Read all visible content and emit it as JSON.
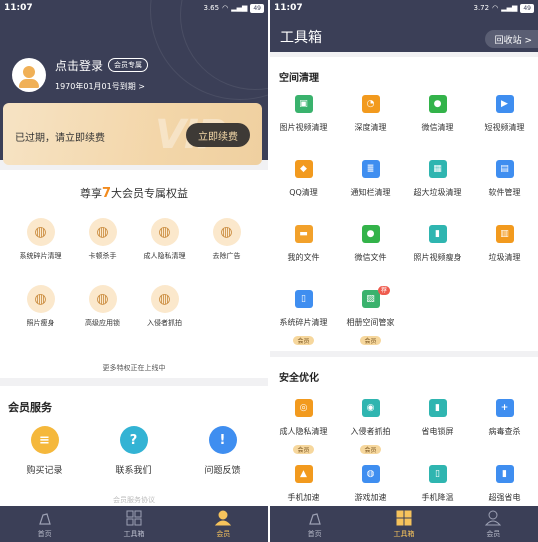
{
  "status_left": {
    "time": "11:07",
    "speed": "3.65\nKB/s"
  },
  "status_right": {
    "time": "11:07",
    "speed": "3.72\nKB/s"
  },
  "battery": "49",
  "account": {
    "login_text": "点击登录",
    "vip_chip": "会员专属",
    "expire_text": "1970年01月01号到期 >",
    "expired_msg": "已过期，请立即续费",
    "renew_button": "立即续费",
    "watermark": "VIP"
  },
  "benefits": {
    "title_pre": "尊享",
    "title_num": "7",
    "title_post": "大会员专属权益",
    "items": [
      {
        "label": "系统碎片清理",
        "icon": "phone-broom-icon"
      },
      {
        "label": "卡顿杀手",
        "icon": "rocket-icon"
      },
      {
        "label": "成人隐私清理",
        "icon": "privacy-icon"
      },
      {
        "label": "去除广告",
        "icon": "no-ad-icon"
      },
      {
        "label": "照片瘦身",
        "icon": "photo-compress-icon"
      },
      {
        "label": "高级应用锁",
        "icon": "lock-icon"
      },
      {
        "label": "入侵者抓拍",
        "icon": "camera-face-icon"
      }
    ],
    "more": "更多特权正在上线中"
  },
  "service": {
    "title": "会员服务",
    "items": [
      {
        "label": "购买记录",
        "icon": "receipt-icon",
        "color": "#f5b83c",
        "glyph": "≡"
      },
      {
        "label": "联系我们",
        "icon": "help-icon",
        "color": "#33b3d4",
        "glyph": "?"
      },
      {
        "label": "问题反馈",
        "icon": "feedback-icon",
        "color": "#3f8ef0",
        "glyph": "!"
      }
    ],
    "agreement": "会员服务协议"
  },
  "tabs_left": [
    {
      "label": "首页",
      "icon": "home-broom-icon",
      "active": false
    },
    {
      "label": "工具箱",
      "icon": "grid-icon",
      "active": false
    },
    {
      "label": "会员",
      "icon": "user-icon",
      "active": true
    }
  ],
  "toolbox": {
    "title": "工具箱",
    "recycle": "回收站 >",
    "space": {
      "title": "空间清理",
      "items": [
        {
          "label": "图片视频清理",
          "icon": "photo-video-icon",
          "color": "#3ab26d",
          "glyph": "▣",
          "vip": ""
        },
        {
          "label": "深度清理",
          "icon": "pie-icon",
          "color": "#f29a1e",
          "glyph": "◔",
          "vip": ""
        },
        {
          "label": "微信清理",
          "icon": "wechat-icon",
          "color": "#33b34a",
          "glyph": "●",
          "vip": ""
        },
        {
          "label": "短视频清理",
          "icon": "short-video-icon",
          "color": "#3f8ef0",
          "glyph": "▶",
          "vip": ""
        },
        {
          "label": "QQ清理",
          "icon": "qq-icon",
          "color": "#f29a1e",
          "glyph": "◆",
          "vip": ""
        },
        {
          "label": "通知栏清理",
          "icon": "notification-icon",
          "color": "#3f8ef0",
          "glyph": "≣",
          "vip": ""
        },
        {
          "label": "超大垃圾清理",
          "icon": "trash-large-icon",
          "color": "#2fb5b0",
          "glyph": "▦",
          "vip": ""
        },
        {
          "label": "软件管理",
          "icon": "app-manage-icon",
          "color": "#3f8ef0",
          "glyph": "▤",
          "vip": ""
        },
        {
          "label": "我的文件",
          "icon": "folder-icon",
          "color": "#f2a12b",
          "glyph": "▬",
          "vip": ""
        },
        {
          "label": "微信文件",
          "icon": "wechat-file-icon",
          "color": "#33b34a",
          "glyph": "●",
          "vip": ""
        },
        {
          "label": "照片视频瘦身",
          "icon": "zip-icon",
          "color": "#2fb5b0",
          "glyph": "▮",
          "vip": ""
        },
        {
          "label": "垃圾清理",
          "icon": "trash-icon",
          "color": "#f29a1e",
          "glyph": "▥",
          "vip": ""
        },
        {
          "label": "系统碎片清理",
          "icon": "phone-broom-icon",
          "color": "#3f8ef0",
          "glyph": "▯",
          "vip": "会员"
        },
        {
          "label": "相册空间管家",
          "icon": "album-icon",
          "color": "#3ab26d",
          "glyph": "▨",
          "vip": "会员",
          "badge": "荐"
        }
      ]
    },
    "security": {
      "title": "安全优化",
      "items": [
        {
          "label": "成人隐私清理",
          "icon": "privacy-icon",
          "color": "#f29a1e",
          "glyph": "◎",
          "vip": "会员"
        },
        {
          "label": "入侵者抓拍",
          "icon": "camera-face-icon",
          "color": "#2fb5b0",
          "glyph": "◉",
          "vip": "会员"
        },
        {
          "label": "省电锁屏",
          "icon": "battery-lock-icon",
          "color": "#2fb5b0",
          "glyph": "▮",
          "vip": ""
        },
        {
          "label": "病毒查杀",
          "icon": "shield-icon",
          "color": "#3f8ef0",
          "glyph": "+",
          "vip": ""
        },
        {
          "label": "手机加速",
          "icon": "rocket-icon",
          "color": "#f29a1e",
          "glyph": "▲",
          "vip": ""
        },
        {
          "label": "游戏加速",
          "icon": "gamepad-icon",
          "color": "#3f8ef0",
          "glyph": "◍",
          "vip": ""
        },
        {
          "label": "手机降温",
          "icon": "thermometer-icon",
          "color": "#2fb5b0",
          "glyph": "▯",
          "vip": ""
        },
        {
          "label": "超强省电",
          "icon": "battery-saver-icon",
          "color": "#3f8ef0",
          "glyph": "▮",
          "vip": ""
        }
      ]
    }
  },
  "tabs_right": [
    {
      "label": "首页",
      "icon": "home-broom-icon",
      "active": false
    },
    {
      "label": "工具箱",
      "icon": "grid-icon",
      "active": true
    },
    {
      "label": "会员",
      "icon": "user-icon",
      "active": false
    }
  ]
}
